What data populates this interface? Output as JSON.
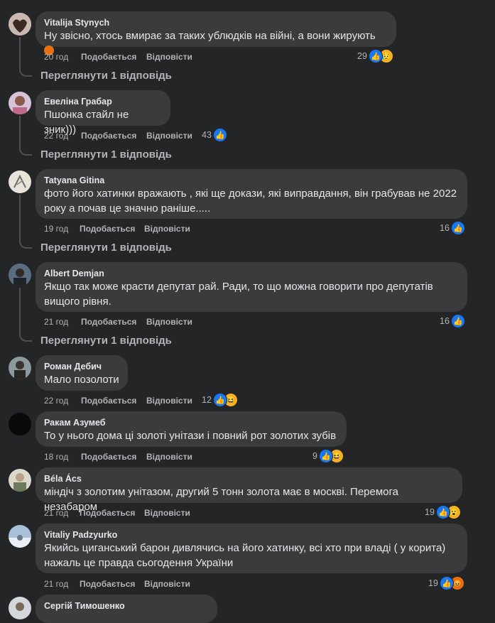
{
  "actions": {
    "like": "Подобається",
    "reply": "Відповісти"
  },
  "view_replies_label": "Переглянути 1 відповідь",
  "comments": [
    {
      "author": "Vitalija Stynych",
      "text": "Ну звісно, хтось вмирає за таких ублюдків на війні, а вони жирують",
      "time": "20 год",
      "reactions": "29",
      "emoji": "angry",
      "reaction_types": [
        "like",
        "sad"
      ]
    },
    {
      "author": "Евеліна Грабар",
      "text": "Пшонка стайл не зник)))",
      "time": "22 год",
      "reactions": "43",
      "reaction_types": [
        "like"
      ]
    },
    {
      "author": "Tatyana Gitina",
      "text_lines": [
        "фото його хатинки вражають , які ще докази, які виправдання, він грабував не 2022",
        "року а почав це значно раніше....."
      ],
      "time": "19 год",
      "reactions": "16",
      "reaction_types": [
        "like"
      ]
    },
    {
      "author": "Albert Demjan",
      "text_lines": [
        "Якщо так може красти депутат рай. Ради, то що можна говорити про депутатів",
        "вищого рівня."
      ],
      "time": "21 год",
      "reactions": "16",
      "reaction_types": [
        "like"
      ]
    },
    {
      "author": "Роман Дебич",
      "text": "Мало позолоти",
      "time": "22 год",
      "reactions": "12",
      "reaction_types": [
        "like",
        "haha"
      ]
    },
    {
      "author": "Ракам Азумеб",
      "text": "То у нього дома ці золоті унітази і повний рот золотих зубів",
      "time": "18 год",
      "reactions": "9",
      "reaction_types": [
        "like",
        "haha"
      ]
    },
    {
      "author": "Béla Ács",
      "text": "міндіч з золотим унітазом, другий 5 тонн золота має в москві. Перемога незабаром",
      "time": "21 год",
      "reactions": "19",
      "reaction_types": [
        "like",
        "wow"
      ]
    },
    {
      "author": "Vitaliy Padzyurko",
      "text_lines": [
        "Якийсь циганський барон дивлячись на його хатинку, всі хто при владі ( у корита)",
        "нажаль це правда сьогодення України"
      ],
      "time": "21 год",
      "reactions": "19",
      "reaction_types": [
        "like",
        "angry"
      ]
    },
    {
      "author": "Сергій Тимошенко"
    }
  ],
  "colors": {
    "background": "#242526",
    "bubble": "#3a3b3c",
    "text": "#e4e6eb",
    "muted": "#b0b3b8",
    "like": "#1877f2"
  }
}
